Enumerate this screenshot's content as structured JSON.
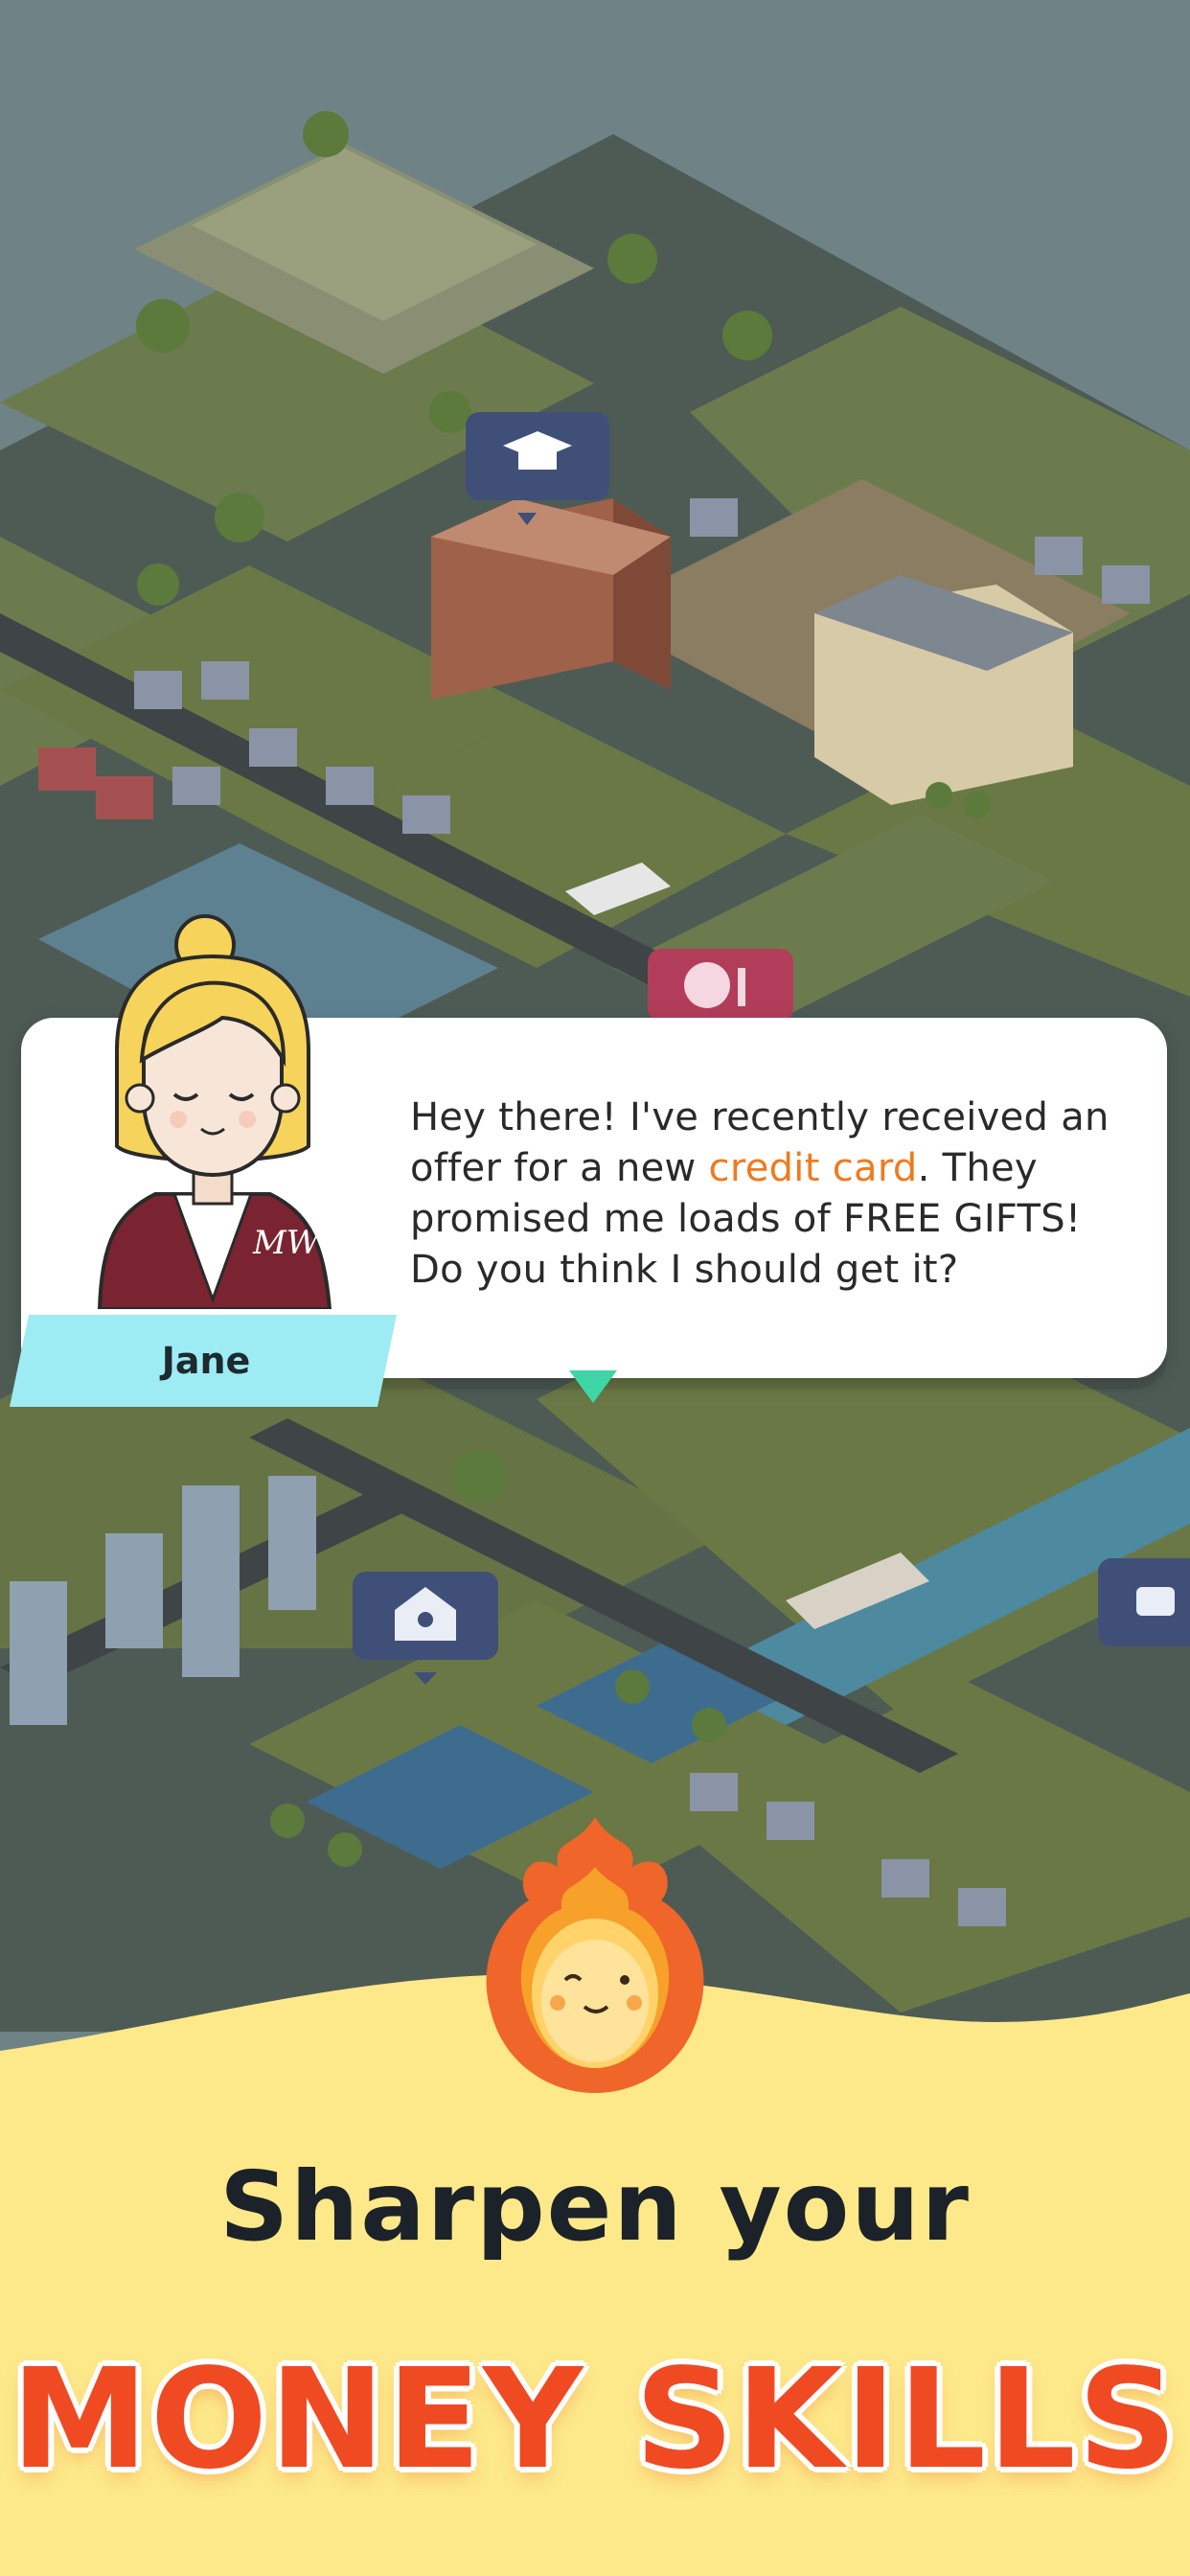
{
  "dialog": {
    "text_before": "Hey there! I've recently received an offer for a new ",
    "highlight": "credit card",
    "text_after": ". They promised me loads of FREE GIFTS! Do you think I should get it?"
  },
  "character": {
    "name": "Jane",
    "jacket_monogram": "MW"
  },
  "tagline": "Sharpen your",
  "hero_text": "MONEY SKILLS",
  "map_markers": [
    "graduation-cap-icon",
    "palette-icon",
    "house-heart-icon",
    "landmark-icon"
  ],
  "colors": {
    "accent_orange": "#f07a1e",
    "hero_red": "#f04a22",
    "nameplate_cyan": "#9eecf3",
    "banner_yellow": "#fde98a"
  }
}
